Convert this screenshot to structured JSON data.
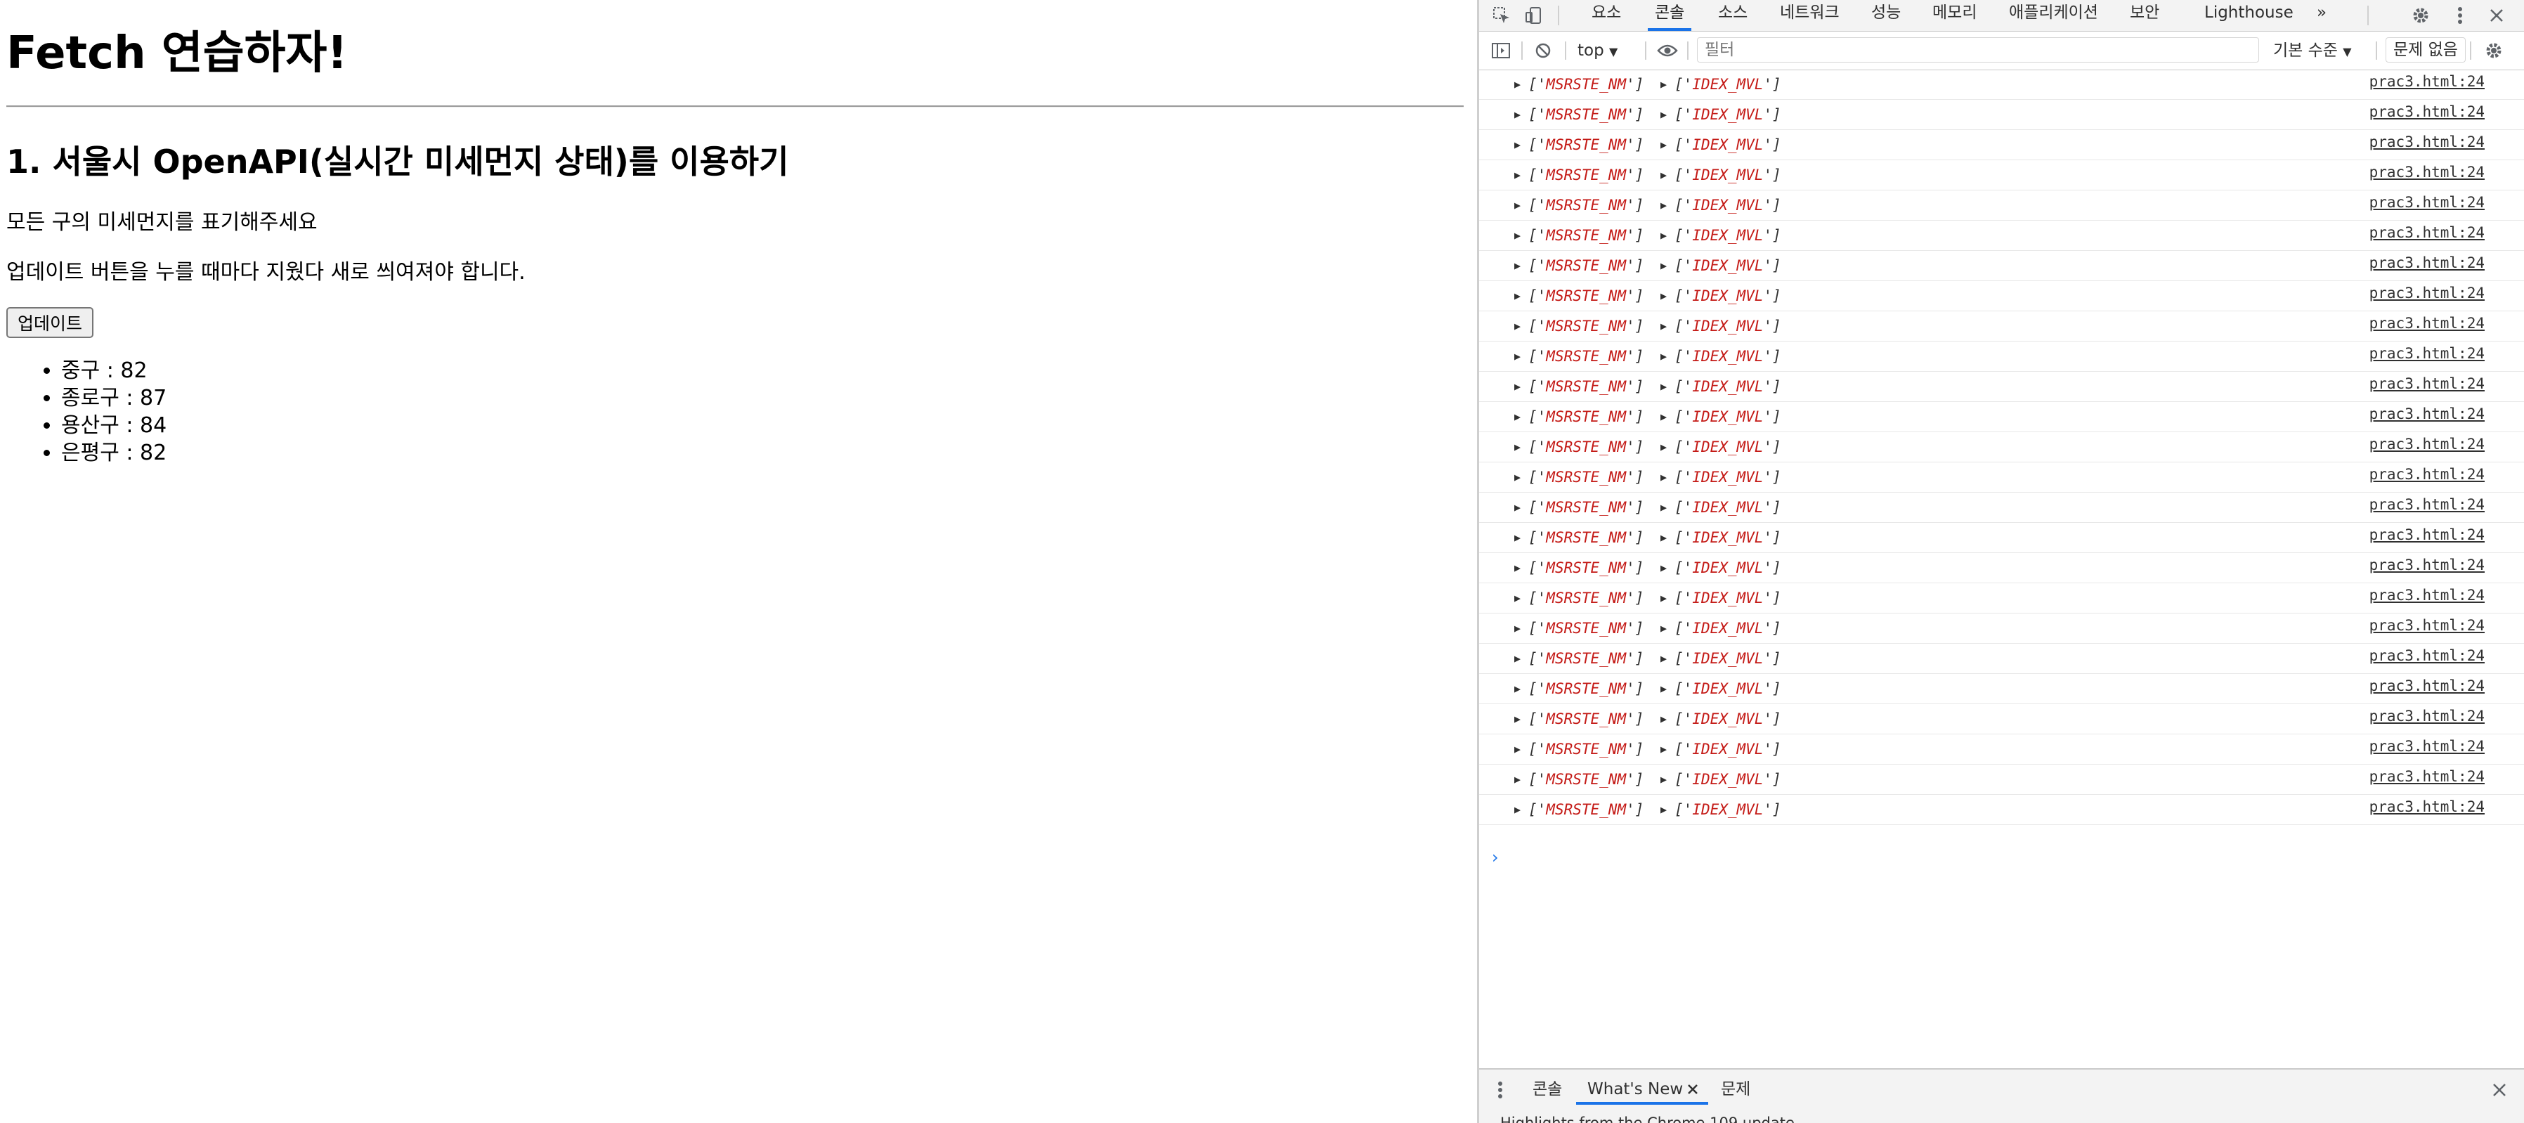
{
  "page": {
    "title": "Fetch 연습하자!",
    "section_heading": "1. 서울시 OpenAPI(실시간 미세먼지 상태)를 이용하기",
    "description_1": "모든 구의 미세먼지를 표기해주세요",
    "description_2": "업데이트 버튼을 누를 때마다 지웠다 새로 씌여져야 합니다.",
    "update_button": "업데이트",
    "districts": [
      "중구 : 82",
      "종로구 : 87",
      "용산구 : 84",
      "은평구 : 82"
    ]
  },
  "devtools": {
    "tabs": [
      "요소",
      "콘솔",
      "소스",
      "네트워크",
      "성능",
      "메모리",
      "애플리케이션",
      "보안",
      "Lighthouse"
    ],
    "active_tab": "콘솔",
    "more_tabs": "»",
    "context": "top",
    "filter_placeholder": "필터",
    "levels": "기본 수준",
    "issues": "문제 없음",
    "log_entry": {
      "arg1_open": "['",
      "arg1_value": "MSRSTE_NM",
      "arg1_close": "']",
      "arg2_open": "['",
      "arg2_value": "IDEX_MVL",
      "arg2_close": "']",
      "source": "prac3.html:24"
    },
    "log_count": 25,
    "prompt": "›",
    "drawer_tabs": [
      "콘솔",
      "What's New",
      "문제"
    ],
    "drawer_active": "What's New",
    "drawer_hint": "Highlights from the Chrome 109 update",
    "icons": [
      "inspect-icon",
      "device-toggle-icon",
      "settings-gear-icon",
      "kebab-menu-icon",
      "close-icon",
      "sidebar-toggle-icon",
      "clear-console-icon",
      "eye-icon",
      "console-settings-icon"
    ]
  }
}
